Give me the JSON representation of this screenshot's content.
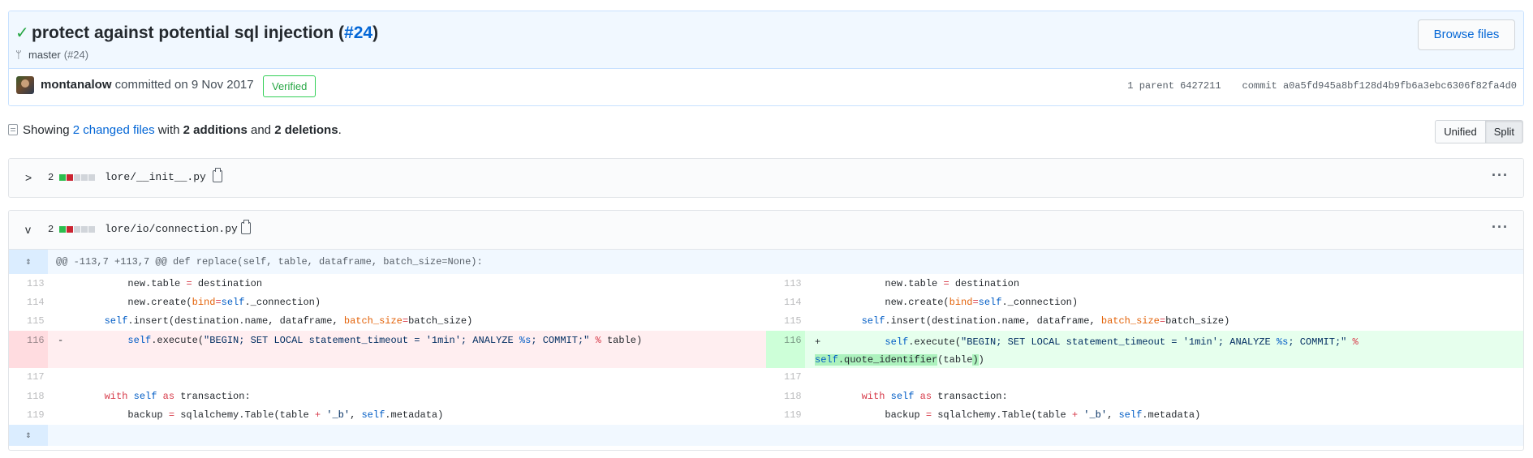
{
  "commit": {
    "title": "protect against potential sql injection (",
    "pr_link": "#24",
    "title_close": ")",
    "branch": "master",
    "branch_pr": "(#24)",
    "browse_label": "Browse files",
    "author": "montanalow",
    "committed_text": " committed on 9 Nov 2017",
    "verified_label": "Verified",
    "parent_label": "1 parent",
    "parent_sha": "6427211",
    "commit_label": "commit",
    "commit_sha": "a0a5fd945a8bf128d4b9fb6a3ebc6306f82fa4d0"
  },
  "toc": {
    "showing": "Showing ",
    "changed_files": "2 changed files",
    "with": " with ",
    "additions": "2 additions",
    "and": " and ",
    "deletions": "2 deletions",
    "period": "."
  },
  "view_toggle": {
    "unified": "Unified",
    "split": "Split",
    "selected": "Split"
  },
  "files": [
    {
      "count": "2",
      "name": "lore/__init__.py",
      "expanded": false,
      "additions": 1,
      "deletions": 1
    },
    {
      "count": "2",
      "name": "lore/io/connection.py",
      "expanded": true,
      "additions": 1,
      "deletions": 1
    }
  ],
  "hunk": {
    "expand_icon": "unfold-icon",
    "header": "@@ -113,7 +113,7 @@ def replace(self, table, dataframe, batch_size=None):"
  },
  "lines": {
    "l113": "113",
    "l114": "114",
    "l115": "115",
    "l116": "116",
    "l117": "117",
    "l118": "118",
    "l119": "119"
  },
  "colors": {
    "accent": "#0366d6",
    "addition": "#2cbe4e",
    "deletion": "#cb2431",
    "verified": "#28a745"
  }
}
